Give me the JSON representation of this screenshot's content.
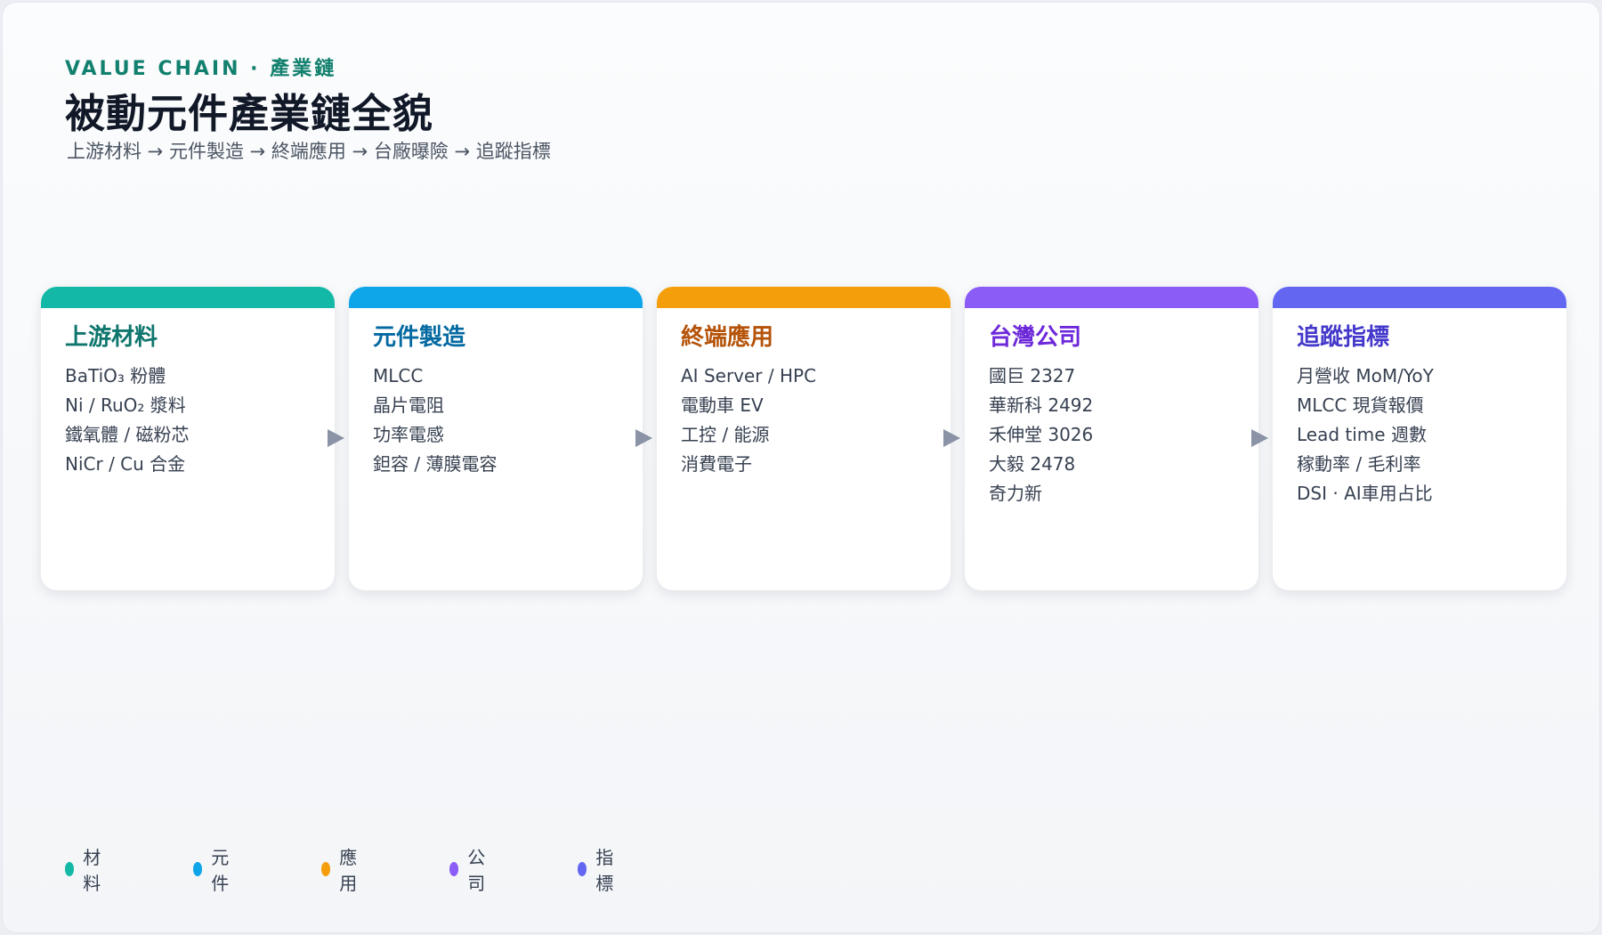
{
  "header": {
    "eyebrow": "VALUE CHAIN · 產業鏈",
    "title": "被動元件產業鏈全貌",
    "subtitle": "上游材料 → 元件製造 → 終端應用 → 台廠曝險 → 追蹤指標"
  },
  "cards": [
    {
      "title": "上游材料",
      "accent": "#14b8a6",
      "title_color": "#0f766e",
      "items": [
        "BaTiO₃ 粉體",
        "Ni / RuO₂ 漿料",
        "鐵氧體 / 磁粉芯",
        "NiCr / Cu 合金"
      ]
    },
    {
      "title": "元件製造",
      "accent": "#0ea5e9",
      "title_color": "#0369a1",
      "items": [
        "MLCC",
        "晶片電阻",
        "功率電感",
        "鉭容 / 薄膜電容"
      ]
    },
    {
      "title": "終端應用",
      "accent": "#f59e0b",
      "title_color": "#b45309",
      "items": [
        "AI Server / HPC",
        "電動車 EV",
        "工控 / 能源",
        "消費電子"
      ]
    },
    {
      "title": "台灣公司",
      "accent": "#8b5cf6",
      "title_color": "#6d28d9",
      "items": [
        "國巨 2327",
        "華新科 2492",
        "禾伸堂 3026",
        "大毅 2478",
        "奇力新"
      ]
    },
    {
      "title": "追蹤指標",
      "accent": "#6366f1",
      "title_color": "#4338ca",
      "items": [
        "月營收 MoM/YoY",
        "MLCC 現貨報價",
        "Lead time 週數",
        "稼動率 / 毛利率",
        "DSI · AI車用占比"
      ]
    }
  ],
  "legend": [
    {
      "label": "材料",
      "color": "#14b8a6"
    },
    {
      "label": "元件",
      "color": "#0ea5e9"
    },
    {
      "label": "應用",
      "color": "#f59e0b"
    },
    {
      "label": "公司",
      "color": "#8b5cf6"
    },
    {
      "label": "指標",
      "color": "#6366f1"
    }
  ]
}
